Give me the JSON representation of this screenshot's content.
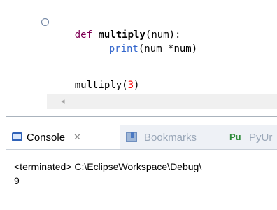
{
  "editor": {
    "lines": [
      {
        "keyword": "def",
        "function_name": "multiply",
        "rest": "(num):"
      },
      {
        "builtin": "print",
        "rest": "(num *num)"
      },
      {
        "call": "multiply(",
        "number": "3",
        "close": ")"
      }
    ]
  },
  "console_view": {
    "tabs": [
      {
        "label": "Console",
        "icon": "console-icon",
        "close_glyph": "✕"
      },
      {
        "label": "Bookmarks",
        "icon": "bookmarks-icon"
      },
      {
        "label": "PyUr",
        "icon": "pyunit-icon",
        "icon_text": "Pu"
      }
    ],
    "status_line": "<terminated> C:\\EclipseWorkspace\\Debug\\",
    "output": "9"
  },
  "colors": {
    "keyword": "#7f0055",
    "builtin": "#3366cc",
    "number": "#ff0000",
    "tab_inactive_text": "#9aa7b8"
  }
}
